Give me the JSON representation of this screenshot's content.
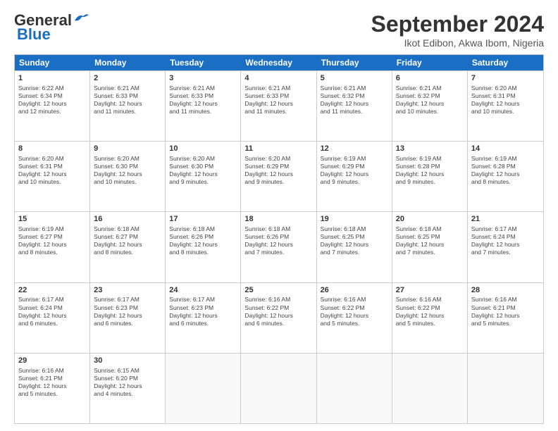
{
  "logo": {
    "line1": "General",
    "line2": "Blue"
  },
  "title": "September 2024",
  "subtitle": "Ikot Edibon, Akwa Ibom, Nigeria",
  "header_days": [
    "Sunday",
    "Monday",
    "Tuesday",
    "Wednesday",
    "Thursday",
    "Friday",
    "Saturday"
  ],
  "rows": [
    [
      {
        "day": "1",
        "lines": [
          "Sunrise: 6:22 AM",
          "Sunset: 6:34 PM",
          "Daylight: 12 hours",
          "and 12 minutes."
        ]
      },
      {
        "day": "2",
        "lines": [
          "Sunrise: 6:21 AM",
          "Sunset: 6:33 PM",
          "Daylight: 12 hours",
          "and 11 minutes."
        ]
      },
      {
        "day": "3",
        "lines": [
          "Sunrise: 6:21 AM",
          "Sunset: 6:33 PM",
          "Daylight: 12 hours",
          "and 11 minutes."
        ]
      },
      {
        "day": "4",
        "lines": [
          "Sunrise: 6:21 AM",
          "Sunset: 6:33 PM",
          "Daylight: 12 hours",
          "and 11 minutes."
        ]
      },
      {
        "day": "5",
        "lines": [
          "Sunrise: 6:21 AM",
          "Sunset: 6:32 PM",
          "Daylight: 12 hours",
          "and 11 minutes."
        ]
      },
      {
        "day": "6",
        "lines": [
          "Sunrise: 6:21 AM",
          "Sunset: 6:32 PM",
          "Daylight: 12 hours",
          "and 10 minutes."
        ]
      },
      {
        "day": "7",
        "lines": [
          "Sunrise: 6:20 AM",
          "Sunset: 6:31 PM",
          "Daylight: 12 hours",
          "and 10 minutes."
        ]
      }
    ],
    [
      {
        "day": "8",
        "lines": [
          "Sunrise: 6:20 AM",
          "Sunset: 6:31 PM",
          "Daylight: 12 hours",
          "and 10 minutes."
        ]
      },
      {
        "day": "9",
        "lines": [
          "Sunrise: 6:20 AM",
          "Sunset: 6:30 PM",
          "Daylight: 12 hours",
          "and 10 minutes."
        ]
      },
      {
        "day": "10",
        "lines": [
          "Sunrise: 6:20 AM",
          "Sunset: 6:30 PM",
          "Daylight: 12 hours",
          "and 9 minutes."
        ]
      },
      {
        "day": "11",
        "lines": [
          "Sunrise: 6:20 AM",
          "Sunset: 6:29 PM",
          "Daylight: 12 hours",
          "and 9 minutes."
        ]
      },
      {
        "day": "12",
        "lines": [
          "Sunrise: 6:19 AM",
          "Sunset: 6:29 PM",
          "Daylight: 12 hours",
          "and 9 minutes."
        ]
      },
      {
        "day": "13",
        "lines": [
          "Sunrise: 6:19 AM",
          "Sunset: 6:28 PM",
          "Daylight: 12 hours",
          "and 9 minutes."
        ]
      },
      {
        "day": "14",
        "lines": [
          "Sunrise: 6:19 AM",
          "Sunset: 6:28 PM",
          "Daylight: 12 hours",
          "and 8 minutes."
        ]
      }
    ],
    [
      {
        "day": "15",
        "lines": [
          "Sunrise: 6:19 AM",
          "Sunset: 6:27 PM",
          "Daylight: 12 hours",
          "and 8 minutes."
        ]
      },
      {
        "day": "16",
        "lines": [
          "Sunrise: 6:18 AM",
          "Sunset: 6:27 PM",
          "Daylight: 12 hours",
          "and 8 minutes."
        ]
      },
      {
        "day": "17",
        "lines": [
          "Sunrise: 6:18 AM",
          "Sunset: 6:26 PM",
          "Daylight: 12 hours",
          "and 8 minutes."
        ]
      },
      {
        "day": "18",
        "lines": [
          "Sunrise: 6:18 AM",
          "Sunset: 6:26 PM",
          "Daylight: 12 hours",
          "and 7 minutes."
        ]
      },
      {
        "day": "19",
        "lines": [
          "Sunrise: 6:18 AM",
          "Sunset: 6:25 PM",
          "Daylight: 12 hours",
          "and 7 minutes."
        ]
      },
      {
        "day": "20",
        "lines": [
          "Sunrise: 6:18 AM",
          "Sunset: 6:25 PM",
          "Daylight: 12 hours",
          "and 7 minutes."
        ]
      },
      {
        "day": "21",
        "lines": [
          "Sunrise: 6:17 AM",
          "Sunset: 6:24 PM",
          "Daylight: 12 hours",
          "and 7 minutes."
        ]
      }
    ],
    [
      {
        "day": "22",
        "lines": [
          "Sunrise: 6:17 AM",
          "Sunset: 6:24 PM",
          "Daylight: 12 hours",
          "and 6 minutes."
        ]
      },
      {
        "day": "23",
        "lines": [
          "Sunrise: 6:17 AM",
          "Sunset: 6:23 PM",
          "Daylight: 12 hours",
          "and 6 minutes."
        ]
      },
      {
        "day": "24",
        "lines": [
          "Sunrise: 6:17 AM",
          "Sunset: 6:23 PM",
          "Daylight: 12 hours",
          "and 6 minutes."
        ]
      },
      {
        "day": "25",
        "lines": [
          "Sunrise: 6:16 AM",
          "Sunset: 6:22 PM",
          "Daylight: 12 hours",
          "and 6 minutes."
        ]
      },
      {
        "day": "26",
        "lines": [
          "Sunrise: 6:16 AM",
          "Sunset: 6:22 PM",
          "Daylight: 12 hours",
          "and 5 minutes."
        ]
      },
      {
        "day": "27",
        "lines": [
          "Sunrise: 6:16 AM",
          "Sunset: 6:22 PM",
          "Daylight: 12 hours",
          "and 5 minutes."
        ]
      },
      {
        "day": "28",
        "lines": [
          "Sunrise: 6:16 AM",
          "Sunset: 6:21 PM",
          "Daylight: 12 hours",
          "and 5 minutes."
        ]
      }
    ],
    [
      {
        "day": "29",
        "lines": [
          "Sunrise: 6:16 AM",
          "Sunset: 6:21 PM",
          "Daylight: 12 hours",
          "and 5 minutes."
        ]
      },
      {
        "day": "30",
        "lines": [
          "Sunrise: 6:15 AM",
          "Sunset: 6:20 PM",
          "Daylight: 12 hours",
          "and 4 minutes."
        ]
      },
      {
        "day": "",
        "lines": []
      },
      {
        "day": "",
        "lines": []
      },
      {
        "day": "",
        "lines": []
      },
      {
        "day": "",
        "lines": []
      },
      {
        "day": "",
        "lines": []
      }
    ]
  ]
}
